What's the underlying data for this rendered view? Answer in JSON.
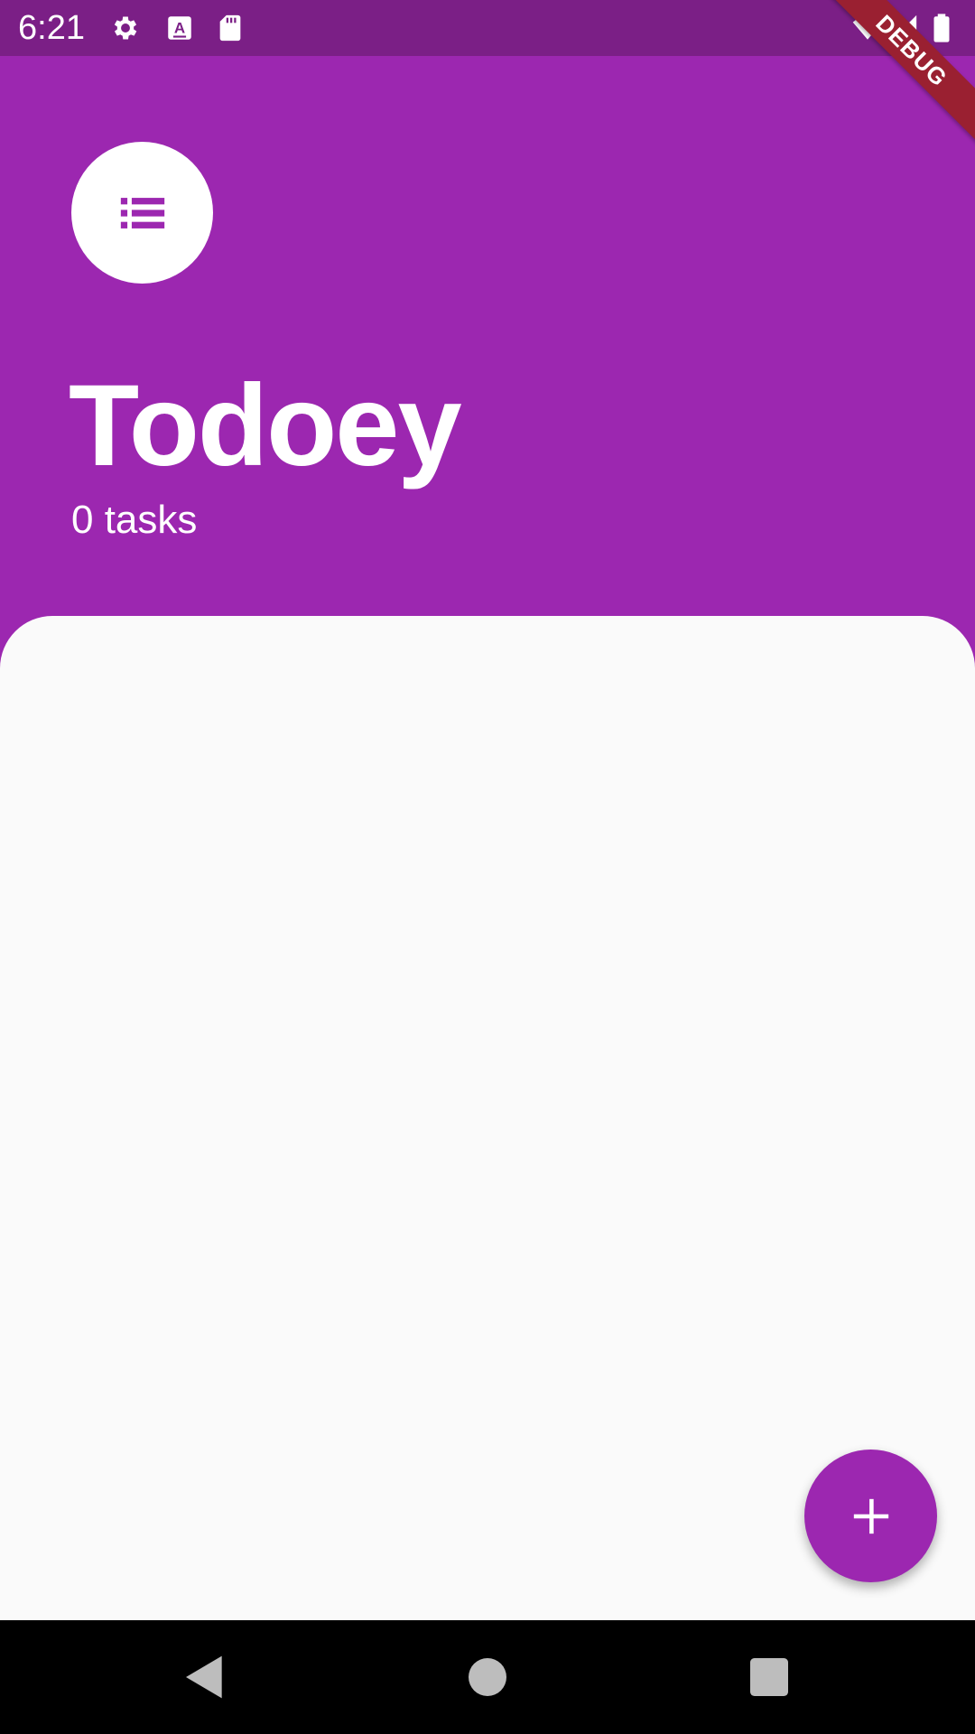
{
  "status_bar": {
    "time": "6:21",
    "icons": [
      "settings-gear-icon",
      "keyboard-a-icon",
      "sd-card-icon",
      "wifi-icon",
      "cell-signal-icon",
      "battery-icon"
    ]
  },
  "debug_banner": {
    "label": "DEBUG",
    "color": "#9a2031"
  },
  "header": {
    "icon": "list-icon",
    "title": "Todoey",
    "subtitle": "0 tasks"
  },
  "fab": {
    "icon": "add-icon"
  },
  "nav_bar": {
    "icons": [
      "back-triangle-icon",
      "home-circle-icon",
      "recents-square-icon"
    ]
  },
  "colors": {
    "primary": "#9c27b0",
    "status_bar": "#7b1f86",
    "panel": "#fafafa",
    "nav_bar": "#000000"
  }
}
